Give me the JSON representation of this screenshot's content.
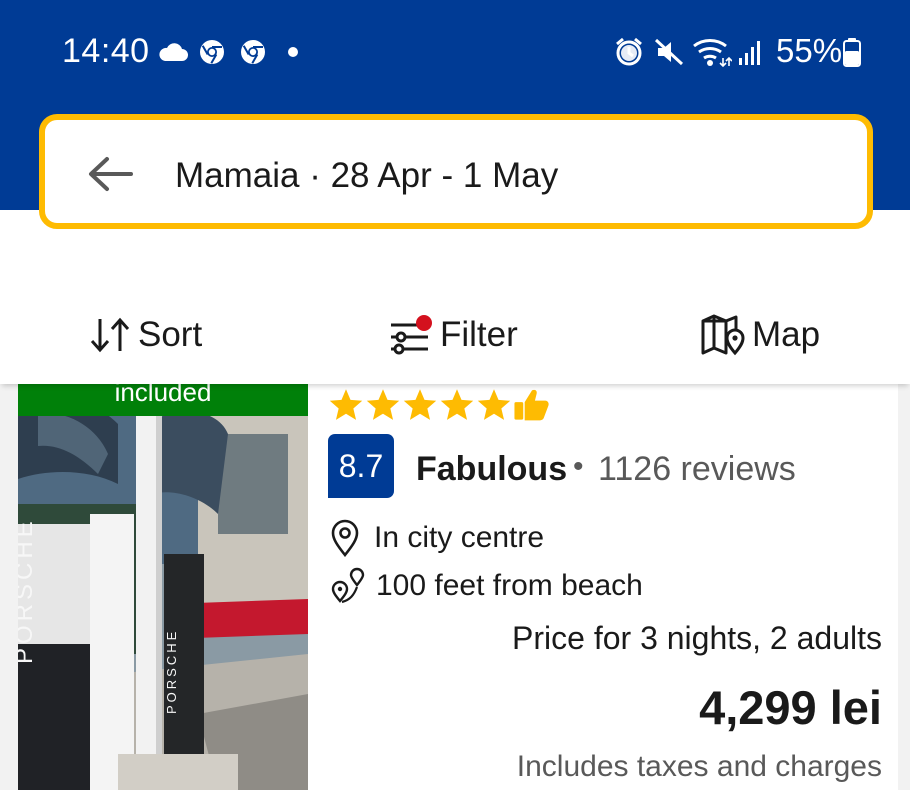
{
  "status_bar": {
    "time": "14:40",
    "battery": "55%",
    "left_icons": [
      "cloud-icon",
      "chrome-icon",
      "chrome-icon",
      "dot-icon"
    ],
    "right_icons": [
      "alarm-icon",
      "mute-icon",
      "wifi-icon",
      "signal-icon",
      "battery-icon"
    ]
  },
  "search": {
    "destination": "Mamaia",
    "separator": "·",
    "dates": "28 Apr - 1 May",
    "summary": "Mamaia · 28 Apr - 1 May"
  },
  "toolbar": {
    "sort_label": "Sort",
    "filter_label": "Filter",
    "map_label": "Map"
  },
  "property": {
    "badge": "included",
    "photo_sign_text": "PORSCHE",
    "stars": 5,
    "rating_score": "8.7",
    "rating_word": "Fabulous",
    "rating_separator": "•",
    "reviews": "1126 reviews",
    "location": "In city centre",
    "beach_distance": "100 feet from beach",
    "price_for": "Price for 3 nights, 2 adults",
    "price": "4,299 lei",
    "taxes_note": "Includes taxes and charges"
  },
  "colors": {
    "brand_blue": "#003b95",
    "search_border": "#febb02",
    "star_yellow": "#febb02",
    "badge_green": "#008009",
    "filter_dot": "#d4111e"
  }
}
